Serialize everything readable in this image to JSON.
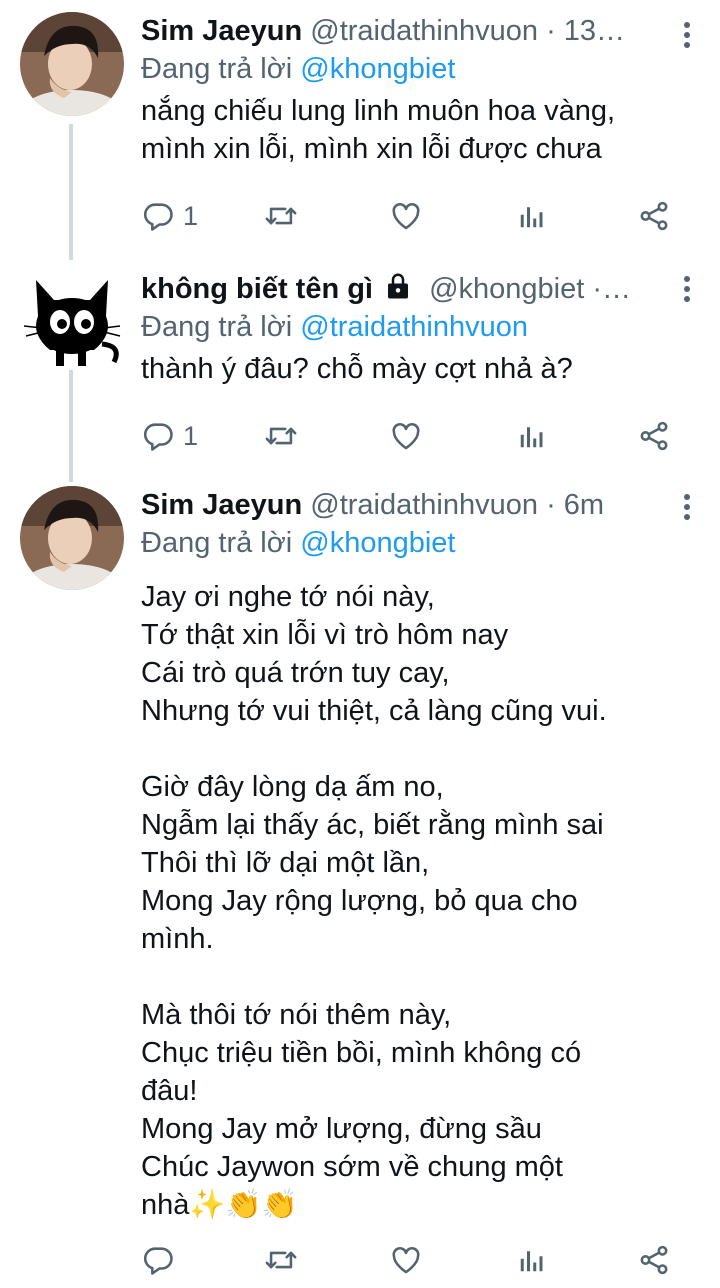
{
  "tweets": [
    {
      "name": "Sim Jaeyun",
      "handle": "@traidathinhvuon",
      "time": "13…",
      "reply_prefix": "Đang trả lời",
      "reply_to": "@khongbiet",
      "text": "nắng chiếu lung linh muôn hoa vàng,\nmình xin lỗi, mình xin lỗi được chưa",
      "reply_count": "1",
      "avatar": "person-photo"
    },
    {
      "name": "không biết tên gì",
      "handle": "@khongbiet",
      "time": "…",
      "reply_prefix": "Đang trả lời",
      "reply_to": "@traidathinhvuon",
      "text": "thành ý đâu? chỗ mày cợt nhả à?",
      "reply_count": "1",
      "avatar": "black-cat",
      "protected_icon": "lock-icon"
    },
    {
      "name": "Sim Jaeyun",
      "handle": "@traidathinhvuon",
      "time": "6m",
      "reply_prefix": "Đang trả lời",
      "reply_to": "@khongbiet",
      "text": "Jay ơi nghe tớ nói này,\nTớ thật xin lỗi vì trò hôm nay\nCái trò quá trớn tuy cay,\nNhưng tớ vui thiệt, cả làng cũng vui.\n\nGiờ đây lòng dạ ấm no,\nNgẫm lại thấy ác, biết rằng mình sai\nThôi thì lỡ dại một lần,\nMong Jay rộng lượng, bỏ qua cho\nmình.\n\nMà thôi tớ nói thêm này,\nChục triệu tiền bồi, mình không có\nđâu!\nMong Jay mở lượng, đừng sầu\nChúc Jaywon sớm về chung một\nnhà✨👏👏",
      "reply_count": "",
      "avatar": "person-photo"
    }
  ],
  "colors": {
    "accent": "#1d9bf0",
    "muted": "#536471",
    "text": "#0f1419",
    "thread": "#cfd9de"
  }
}
